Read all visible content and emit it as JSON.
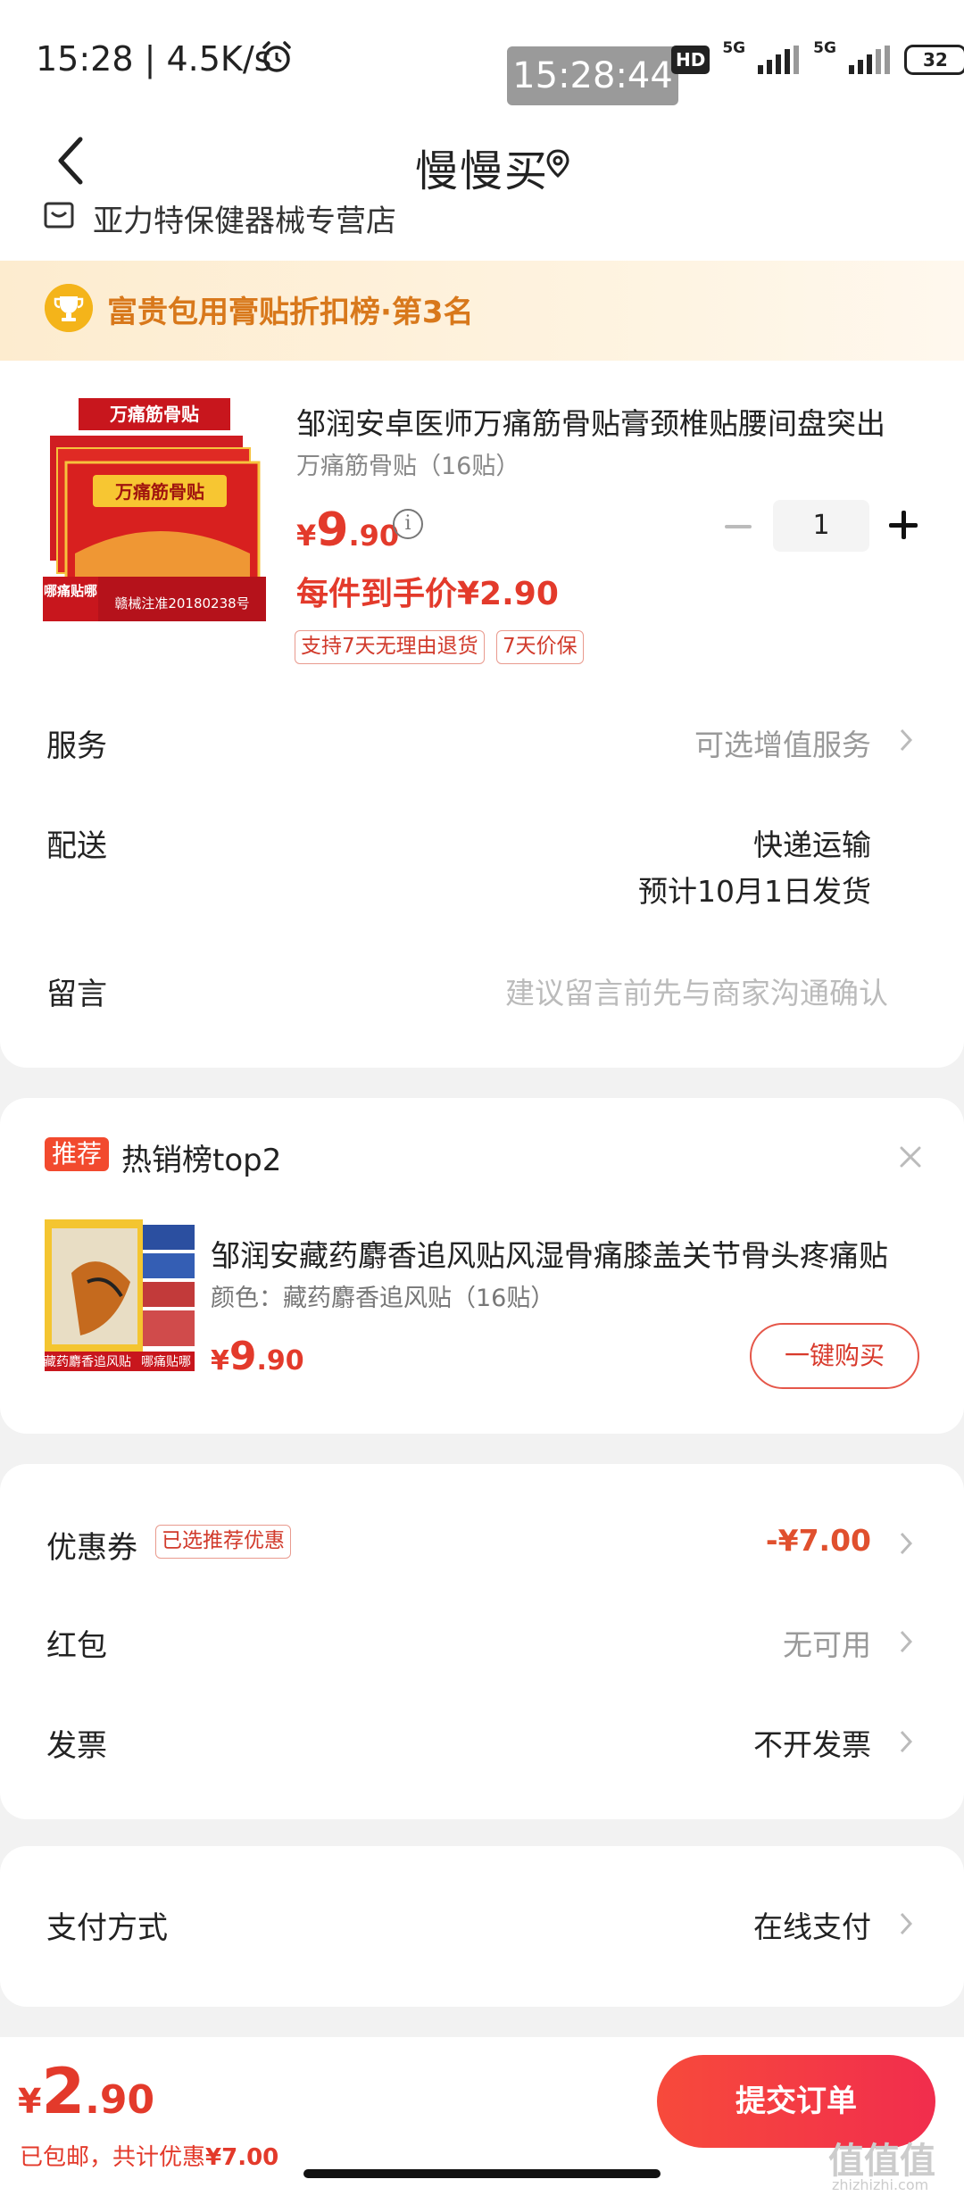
{
  "status_bar": {
    "time": "15:28 | 4.5K/s",
    "clock_overlay": "15:28:44",
    "hd": "HD",
    "net1": "5G",
    "net2": "5G",
    "battery": "32"
  },
  "header": {
    "title": "慢慢买"
  },
  "store": {
    "name": "亚力特保健器械专营店"
  },
  "rank_banner": {
    "text": "富贵包用膏贴折扣榜·第3名"
  },
  "product": {
    "thumb_label_top": "万痛筋骨贴",
    "thumb_label_main": "万痛筋骨贴",
    "thumb_label_left": "哪痛贴哪",
    "thumb_label_reg": "赣械注准20180238号",
    "title": "邹润安卓医师万痛筋骨贴膏颈椎贴腰间盘突出",
    "spec": "万痛筋骨贴（16贴）",
    "price_currency": "¥",
    "price_int": "9",
    "price_dec": ".90",
    "final_price": "每件到手价¥2.90",
    "tags": [
      "支持7天无理由退货",
      "7天价保"
    ],
    "quantity": "1"
  },
  "order_rows": {
    "service_label": "服务",
    "service_value": "可选增值服务",
    "delivery_label": "配送",
    "delivery_method": "快递运输",
    "delivery_date": "预计10月1日发货",
    "message_label": "留言",
    "message_placeholder": "建议留言前先与商家沟通确认"
  },
  "recommend": {
    "badge": "推荐",
    "title": "热销榜top2",
    "thumb_caption_left": "藏药麝香追风贴",
    "thumb_caption_right": "哪痛贴哪",
    "name": "邹润安藏药麝香追风贴风湿骨痛膝盖关节骨头疼痛贴",
    "spec": "颜色：藏药麝香追风贴（16贴）",
    "price_currency": "¥",
    "price_int": "9",
    "price_dec": ".90",
    "buy_label": "一键购买"
  },
  "discounts": {
    "coupon_label": "优惠券",
    "coupon_tag": "已选推荐优惠",
    "coupon_value": "-¥7.00",
    "redpacket_label": "红包",
    "redpacket_value": "无可用",
    "invoice_label": "发票",
    "invoice_value": "不开发票"
  },
  "payment": {
    "label": "支付方式",
    "value": "在线支付"
  },
  "bottom": {
    "currency": "¥",
    "total_int": "2",
    "total_dec": ".90",
    "note_prefix": "已包邮，共计优惠",
    "note_amount": "¥7.00",
    "submit_label": "提交订单",
    "watermark": "值值值",
    "watermark_url": "zhizhizhi.com"
  },
  "colors": {
    "accent": "#e33a2b",
    "submit_start": "#f74a3b",
    "submit_end": "#f12d4d",
    "rank_text": "#d8781b"
  }
}
